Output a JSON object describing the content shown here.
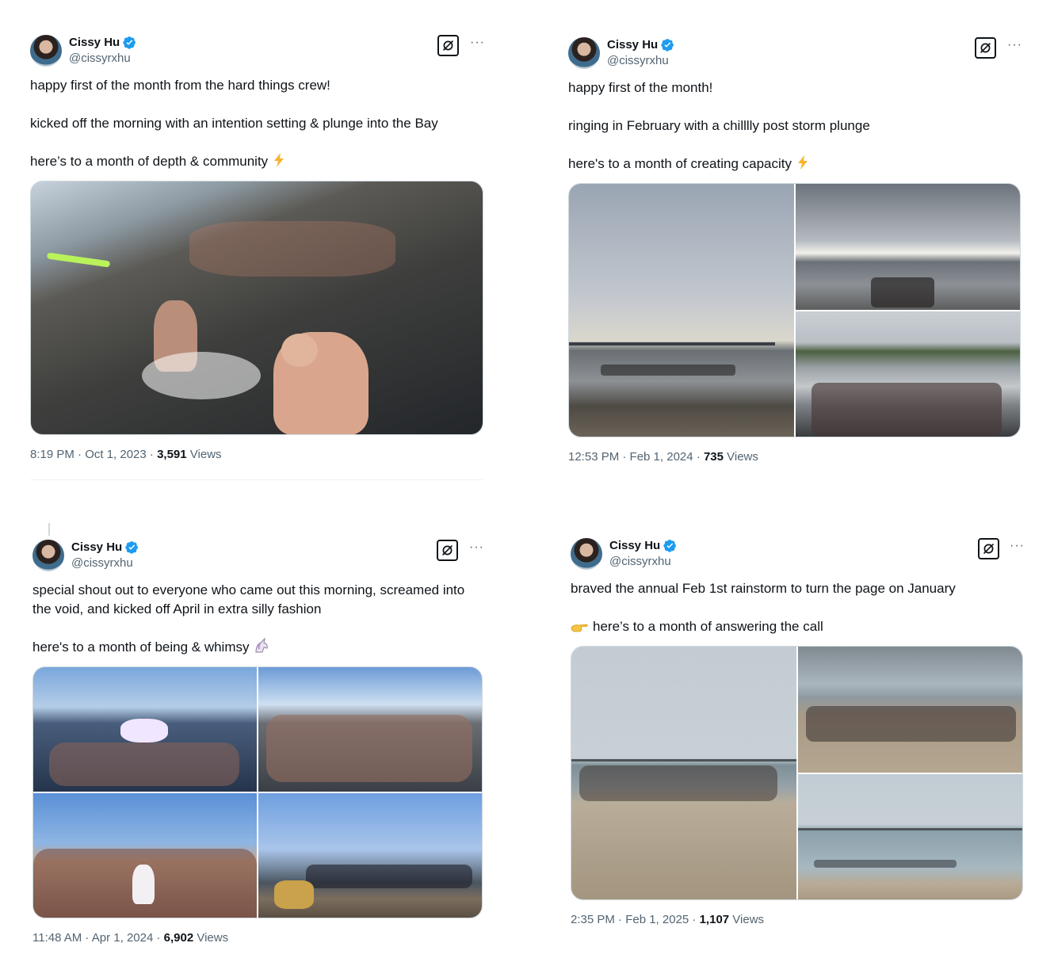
{
  "colors": {
    "verified": "#1d9bf0",
    "muted": "#536471",
    "text": "#0f1419",
    "border": "#cfd9de"
  },
  "icons": {
    "verified": "verified-badge-icon",
    "grok": "grok-icon",
    "more": "more-icon",
    "lightning": "high-voltage-emoji",
    "unicorn": "unicorn-emoji",
    "pointing": "backhand-index-pointing-right-emoji"
  },
  "tweets": [
    {
      "name": "Cissy Hu",
      "handle": "@cissyrxhu",
      "more": "···",
      "lines": [
        "happy first of the month from the hard things crew!",
        "kicked off the morning with an intention setting & plunge into the Bay",
        "here’s to a month of depth & community"
      ],
      "time": "8:19 PM · Oct 1, 2023 · ",
      "views_count": "3,591",
      "views_label": " Views"
    },
    {
      "name": "Cissy Hu",
      "handle": "@cissyrxhu",
      "more": "···",
      "lines": [
        "happy first of the month!",
        "ringing in February with a chilllly post storm plunge",
        "here's to a month of creating capacity"
      ],
      "time": "12:53 PM · Feb 1, 2024 · ",
      "views_count": "735",
      "views_label": " Views"
    },
    {
      "name": "Cissy Hu",
      "handle": "@cissyrxhu",
      "more": "···",
      "lines": [
        "special shout out to everyone who came out this morning, screamed into the void, and kicked off April in extra silly fashion",
        "here's to a month of being & whimsy"
      ],
      "time": "11:48 AM · Apr 1, 2024 · ",
      "views_count": "6,902",
      "views_label": " Views"
    },
    {
      "name": "Cissy Hu",
      "handle": "@cissyrxhu",
      "more": "···",
      "lines": [
        "braved the annual Feb 1st rainstorm to turn the page on January",
        "here’s to a month of answering the call"
      ],
      "time": "2:35 PM · Feb 1, 2025 · ",
      "views_count": "1,107",
      "views_label": " Views"
    }
  ]
}
